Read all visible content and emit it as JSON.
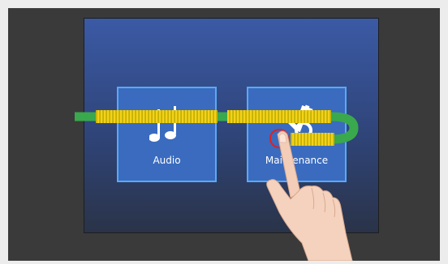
{
  "tiles": [
    {
      "label": "Audio",
      "icon": "music-note-icon"
    },
    {
      "label": "Maintenance",
      "icon": "tools-icon"
    }
  ],
  "gesture": {
    "type": "swipe",
    "hand_icon": "pointing-hand-icon",
    "touch_marker": "red-ring-icon",
    "colors": {
      "track": "#3aa84c",
      "ridges": "#f4d21a",
      "marker": "#e02020"
    }
  }
}
